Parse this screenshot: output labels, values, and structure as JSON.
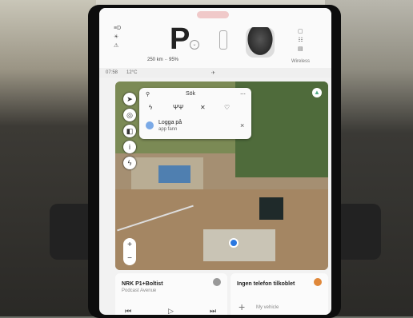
{
  "status": {
    "gear": "P",
    "left_indicators": [
      "≡D",
      "☀",
      "⚠"
    ],
    "range": "250 km  ··  95%",
    "right_indicators": [
      "▢",
      "☷",
      "▤"
    ],
    "right_label": "Wireless"
  },
  "info_bar": {
    "time": "07:58",
    "temp": "12°C",
    "mid": "✈"
  },
  "map": {
    "left_buttons": [
      {
        "icon": "navigation-icon",
        "glyph": "➤"
      },
      {
        "icon": "compass-icon",
        "glyph": "◎"
      },
      {
        "icon": "layers-icon",
        "glyph": "◧"
      },
      {
        "icon": "info-icon",
        "glyph": "i"
      },
      {
        "icon": "lightning-icon",
        "glyph": "ϟ"
      }
    ],
    "zoom_in": "+",
    "zoom_out": "−"
  },
  "nav_panel": {
    "title": "Sök",
    "quick_actions": [
      "ϟ",
      "ΨΨ",
      "✕",
      "♡"
    ],
    "result_title": "Logga på",
    "result_sub": "app fann",
    "close": "×"
  },
  "media": {
    "title": "NRK P1+Boltist",
    "subtitle": "Podcast Avenue",
    "prev": "⏮",
    "play": "▷",
    "next": "⏭"
  },
  "second_card": {
    "title": "Ingen telefon tilkoblet",
    "add_label": "My vehicle"
  },
  "colors": {
    "accent": "#2a78e0",
    "orange": "#e0883a"
  }
}
